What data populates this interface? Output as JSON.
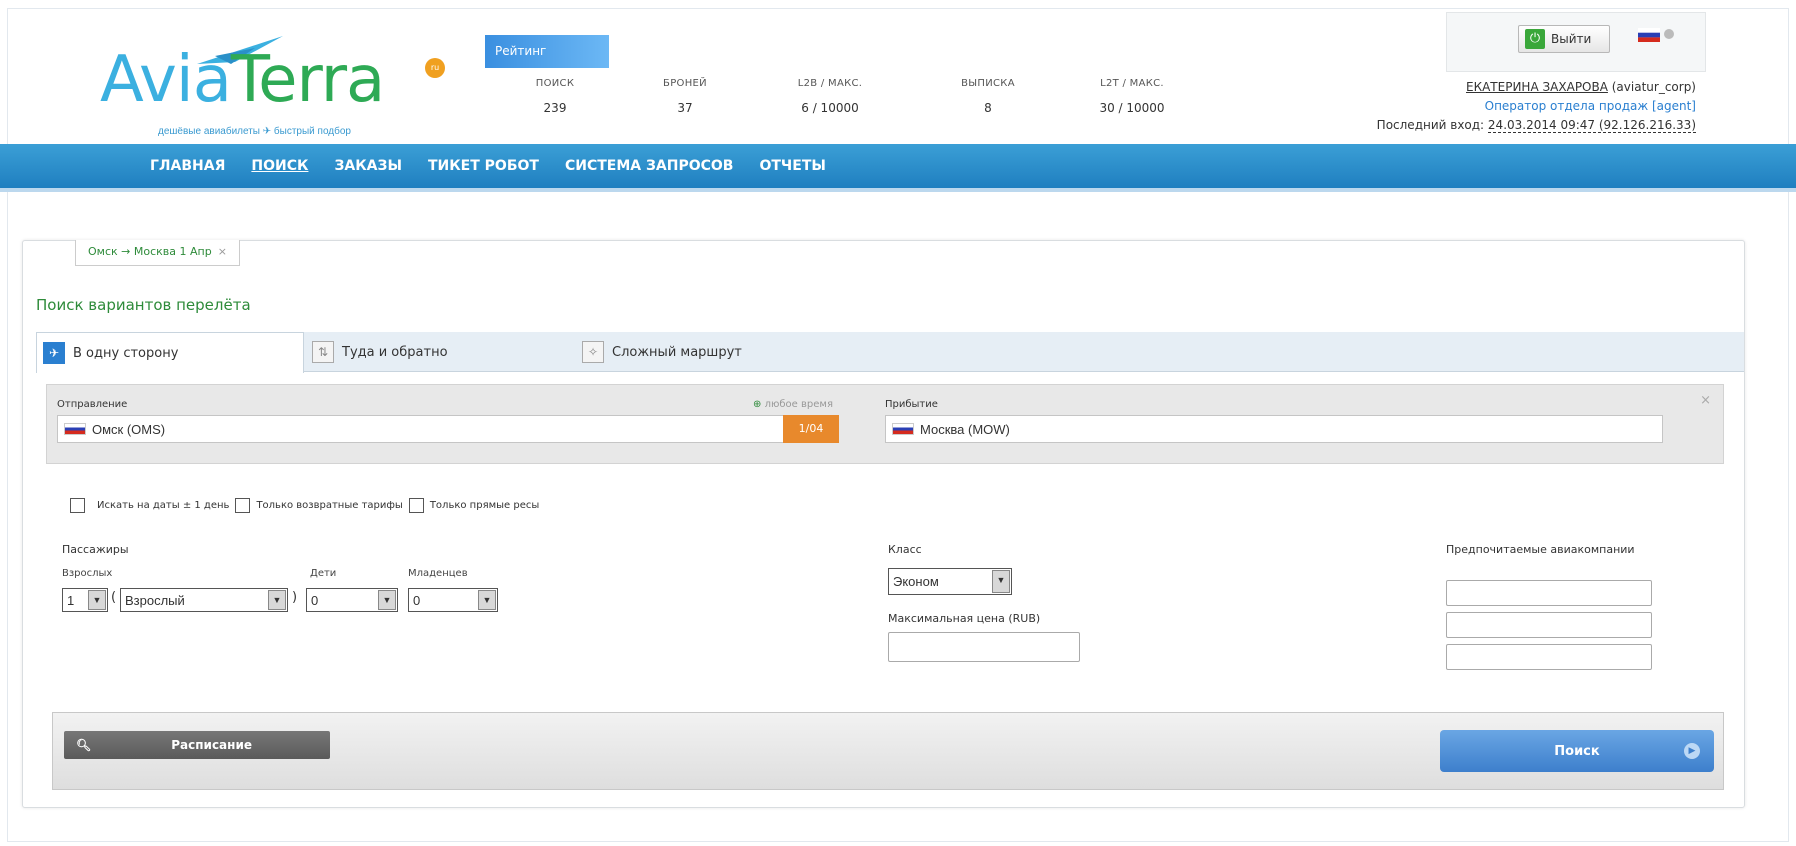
{
  "brand": {
    "name_part1": "Avia",
    "name_part2": "Terra",
    "ru_badge": "ru",
    "tagline": "дешёвые авиабилеты ✈ быстрый подбор"
  },
  "header": {
    "rating_label": "Рейтинг",
    "stats": [
      {
        "label": "ПОИСК",
        "value": "239"
      },
      {
        "label": "БРОНЕЙ",
        "value": "37"
      },
      {
        "label": "L2B / МАКС.",
        "value": "6 / 10000"
      },
      {
        "label": "ВЫПИСКА",
        "value": "8"
      },
      {
        "label": "L2T / МАКС.",
        "value": "30 / 10000"
      }
    ],
    "logout_label": "Выйти",
    "user_name": "ЕКАТЕРИНА ЗАХАРОВА",
    "user_login": " (aviatur_corp)",
    "user_role": "Оператор отдела продаж [agent]",
    "last_login_label": "Последний вход: ",
    "last_login_value": "24.03.2014 09:47 (92.126.216.33)"
  },
  "nav": {
    "items": [
      "ГЛАВНАЯ",
      "ПОИСК",
      "ЗАКАЗЫ",
      "ТИКЕТ РОБОТ",
      "СИСТЕМА ЗАПРОСОВ",
      "ОТЧЕТЫ"
    ],
    "active": "ПОИСК"
  },
  "route_tab": {
    "label": "Омск → Москва 1 Апр",
    "close": "×"
  },
  "search": {
    "title": "Поиск вариантов перелёта",
    "tabs": [
      "В одну сторону",
      "Туда и обратно",
      "Сложный маршрут"
    ],
    "departure_label": "Отправление",
    "any_time": "любое время",
    "departure_value": "Омск (OMS)",
    "date_value": "1/04",
    "arrival_label": "Прибытие",
    "arrival_value": "Москва (MOW)",
    "close": "×",
    "checkboxes": [
      "Искать на даты ± 1 день",
      "Только возвратные тарифы",
      "Только прямые ресы"
    ],
    "passengers_label": "Пассажиры",
    "adults_label": "Взрослых",
    "adults_value": "1",
    "adult_type_value": "Взрослый",
    "children_label": "Дети",
    "children_value": "0",
    "infants_label": "Младенцев",
    "infants_value": "0",
    "class_label": "Класс",
    "class_value": "Эконом",
    "max_price_label": "Максимальная цена (RUB)",
    "airlines_label": "Предпочитаемые авиакомпании",
    "schedule_button": "Расписание",
    "search_button": "Поиск"
  },
  "colors": {
    "nav_blue": "#1f7fc0",
    "accent_green": "#2e8b3a",
    "date_orange": "#e8892c",
    "search_blue": "#3d7fcc"
  }
}
